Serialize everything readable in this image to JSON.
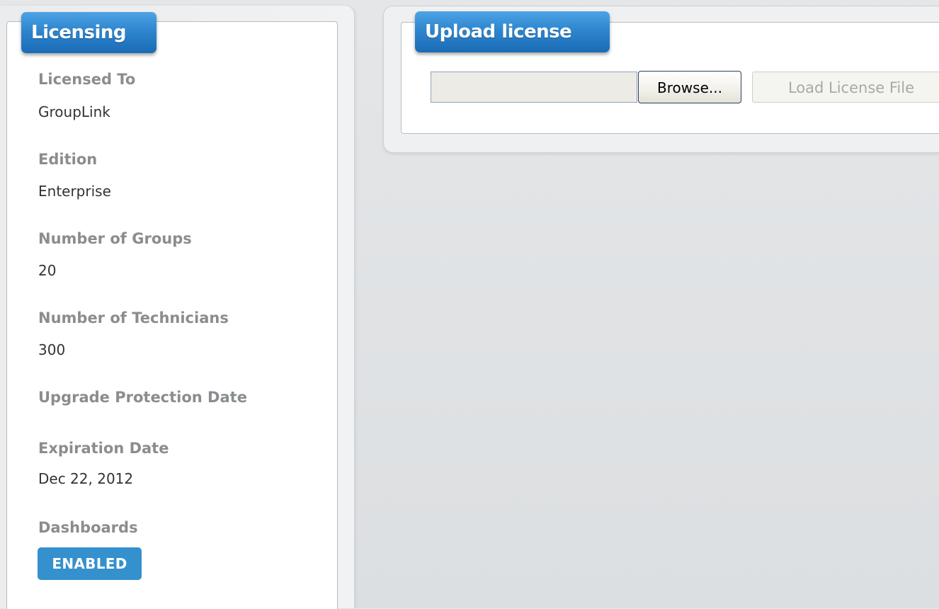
{
  "licensing": {
    "title": "Licensing",
    "fields": [
      {
        "label": "Licensed To",
        "value": "GroupLink"
      },
      {
        "label": "Edition",
        "value": "Enterprise"
      },
      {
        "label": "Number of Groups",
        "value": "20"
      },
      {
        "label": "Number of Technicians",
        "value": "300"
      },
      {
        "label": "Upgrade Protection Date",
        "value": ""
      },
      {
        "label": "Expiration Date",
        "value": "Dec 22, 2012"
      },
      {
        "label": "Dashboards",
        "value": ""
      }
    ],
    "dashboards_badge": "ENABLED"
  },
  "upload": {
    "title": "Upload license",
    "file_value": "",
    "browse_label": "Browse...",
    "load_label": "Load License File"
  },
  "colors": {
    "tab_blue": "#2e86cf",
    "badge_blue": "#3590ce",
    "label_gray": "#8a8d90",
    "value_text": "#333333"
  }
}
